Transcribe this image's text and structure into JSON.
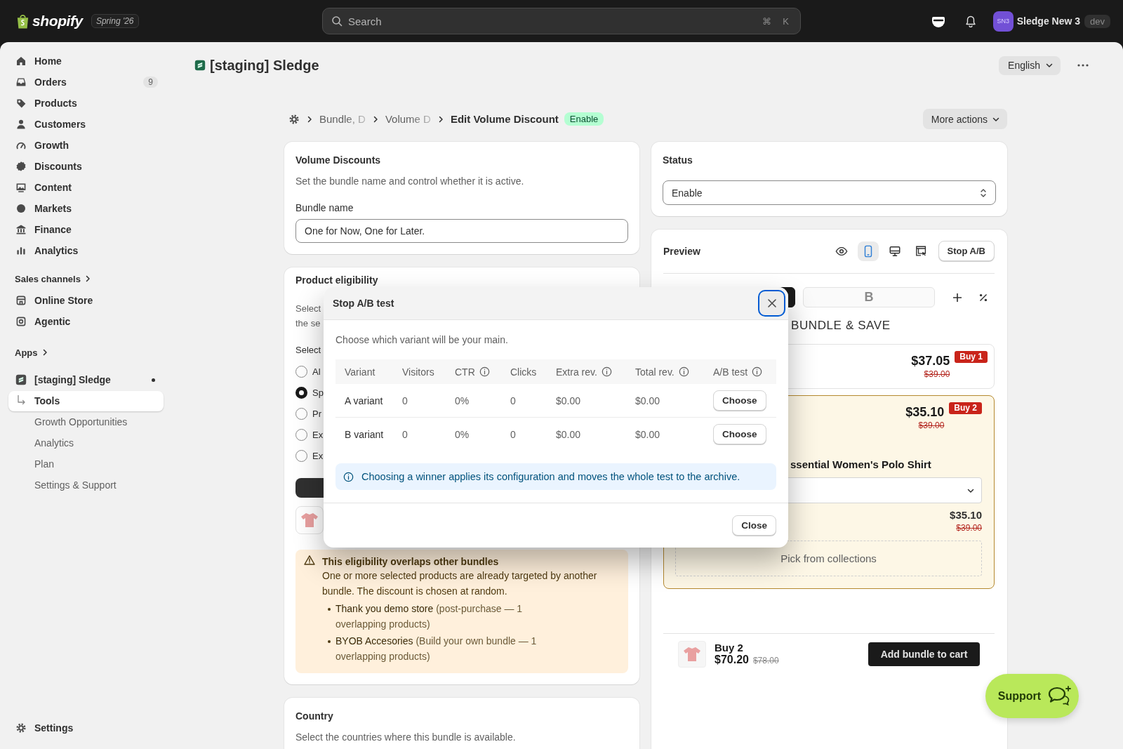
{
  "topbar": {
    "brand": "shopify",
    "edition": "Spring '26",
    "search": {
      "placeholder": "Search",
      "shortcut": [
        "⌘",
        "K"
      ]
    },
    "account": {
      "initials": "SN3",
      "name": "Sledge New 3",
      "badge": "dev"
    }
  },
  "sidebar": {
    "items": [
      {
        "label": "Home",
        "selected": false
      },
      {
        "label": "Orders",
        "badge": "9",
        "selected": false
      },
      {
        "label": "Products",
        "selected": false
      },
      {
        "label": "Customers",
        "selected": false
      },
      {
        "label": "Growth",
        "selected": false
      },
      {
        "label": "Discounts",
        "selected": false
      },
      {
        "label": "Content",
        "selected": false
      },
      {
        "label": "Markets",
        "selected": false
      },
      {
        "label": "Finance",
        "selected": false
      },
      {
        "label": "Analytics",
        "selected": false
      }
    ],
    "sales_channels": {
      "title": "Sales channels",
      "items": [
        {
          "label": "Online Store",
          "selected": false
        },
        {
          "label": "Agentic",
          "selected": false
        }
      ]
    },
    "apps": {
      "title": "Apps",
      "items": [
        {
          "label": "[staging] Sledge",
          "selected": false,
          "children": [
            {
              "label": "Tools",
              "selected": true
            },
            {
              "label": "Growth Opportunities",
              "selected": false
            },
            {
              "label": "Analytics",
              "selected": false
            },
            {
              "label": "Plan",
              "selected": false
            },
            {
              "label": "Settings & Support",
              "selected": false
            }
          ]
        }
      ]
    },
    "footer": {
      "label": "Settings",
      "selected": false
    }
  },
  "header": {
    "app_title": "[staging] Sledge",
    "language": "English"
  },
  "breadcrumb": {
    "items": [
      "Bundle, D",
      "Volume D"
    ],
    "current": "Edit Volume Discount",
    "status": "Enable",
    "more_actions": "More actions"
  },
  "volume_card": {
    "title": "Volume Discounts",
    "description": "Set the bundle name and control whether it is active.",
    "field_label": "Bundle name",
    "field_value": "One for Now, One for Later."
  },
  "eligibility_card": {
    "title": "Product eligibility",
    "description_lines": [
      "Select",
      "the se"
    ],
    "select_label": "Select",
    "options": [
      {
        "label": "Al",
        "selected": false
      },
      {
        "label": "Sp",
        "selected": true
      },
      {
        "label": "Pr",
        "selected": false
      },
      {
        "label": "Ex",
        "selected": false
      },
      {
        "label": "Ex",
        "selected": false
      }
    ],
    "warning": {
      "title": "This eligibility overlaps other bundles",
      "text": "One or more selected products are already targeted by another bundle. The discount is chosen at random.",
      "items": [
        {
          "name": "Thank you demo store",
          "detail": "(post-purchase — 1 overlapping products)"
        },
        {
          "name": "BYOB Accesories",
          "detail": "(Build your own bundle — 1 overlapping products)"
        }
      ]
    }
  },
  "country_card": {
    "title": "Country",
    "description": "Select the countries where this bundle is available."
  },
  "status_card": {
    "title": "Status",
    "value": "Enable"
  },
  "preview": {
    "title": "Preview",
    "views": [
      {
        "selected": false
      },
      {
        "selected": true
      },
      {
        "selected": false
      },
      {
        "selected": false
      }
    ],
    "stop_label": "Stop A/B",
    "variant_tabs": [
      {
        "selected": true
      },
      {
        "label": "B",
        "selected": false
      }
    ],
    "heading": "BUNDLE & SAVE",
    "options": [
      {
        "selected": false,
        "price": "$37.05",
        "compare_price": "$39.00",
        "badge": "Buy 1"
      },
      {
        "selected": true,
        "price": "$35.10",
        "compare_price": "$39.00",
        "badge": "Buy 2",
        "product": "ssential Women's Polo Shirt",
        "line_price": "$35.10",
        "line_compare_price": "$39.00",
        "picker": "Pick from collections"
      }
    ],
    "summary": {
      "quantity": "Buy 2",
      "price": "$70.20",
      "compare_price": "$78.00"
    },
    "cta": "Add bundle to cart"
  },
  "modal": {
    "title": "Stop A/B test",
    "close_focused": true,
    "description": "Choose which variant will be your main.",
    "columns": [
      {
        "label": "Variant",
        "info": false
      },
      {
        "label": "Visitors",
        "info": false
      },
      {
        "label": "CTR",
        "info": true
      },
      {
        "label": "Clicks",
        "info": false
      },
      {
        "label": "Extra rev.",
        "info": true
      },
      {
        "label": "Total rev.",
        "info": true
      },
      {
        "label": "A/B test",
        "info": true
      }
    ],
    "rows": [
      {
        "cells": [
          "A variant",
          "0",
          "0%",
          "0",
          "$0.00",
          "$0.00"
        ],
        "action": "Choose"
      },
      {
        "cells": [
          "B variant",
          "0",
          "0%",
          "0",
          "$0.00",
          "$0.00"
        ],
        "action": "Choose"
      }
    ],
    "notice": "Choosing a winner applies its configuration and moves the whole test to the archive.",
    "close_label": "Close"
  },
  "support": {
    "label": "Support"
  }
}
